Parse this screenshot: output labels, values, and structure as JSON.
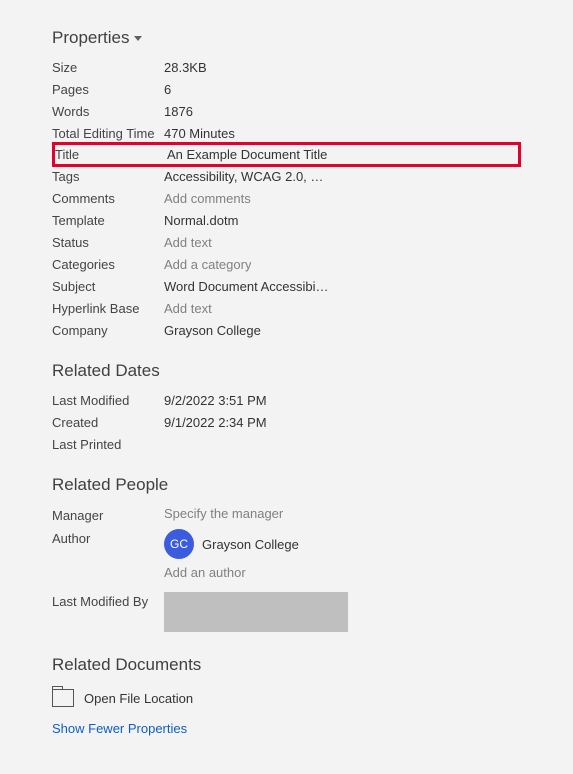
{
  "properties_header": "Properties",
  "properties": [
    {
      "label": "Size",
      "value": "28.3KB",
      "interactable": false
    },
    {
      "label": "Pages",
      "value": "6",
      "interactable": false
    },
    {
      "label": "Words",
      "value": "1876",
      "interactable": false
    },
    {
      "label": "Total Editing Time",
      "value": "470 Minutes",
      "interactable": false
    },
    {
      "label": "Title",
      "value": "An Example Document Title",
      "interactable": true,
      "highlight": true
    },
    {
      "label": "Tags",
      "value": "Accessibility, WCAG 2.0, …",
      "interactable": true
    },
    {
      "label": "Comments",
      "value": "Add comments",
      "placeholder": true,
      "interactable": true
    },
    {
      "label": "Template",
      "value": "Normal.dotm",
      "interactable": false
    },
    {
      "label": "Status",
      "value": "Add text",
      "placeholder": true,
      "interactable": true
    },
    {
      "label": "Categories",
      "value": "Add a category",
      "placeholder": true,
      "interactable": true
    },
    {
      "label": "Subject",
      "value": "Word Document Accessibi…",
      "interactable": true
    },
    {
      "label": "Hyperlink Base",
      "value": "Add text",
      "placeholder": true,
      "interactable": true
    },
    {
      "label": "Company",
      "value": "Grayson College",
      "interactable": true
    }
  ],
  "related_dates_header": "Related Dates",
  "related_dates": [
    {
      "label": "Last Modified",
      "value": "9/2/2022 3:51 PM"
    },
    {
      "label": "Created",
      "value": "9/1/2022 2:34 PM"
    },
    {
      "label": "Last Printed",
      "value": ""
    }
  ],
  "related_people_header": "Related People",
  "manager_label": "Manager",
  "manager_placeholder": "Specify the manager",
  "author_label": "Author",
  "author_initials": "GC",
  "author_name": "Grayson College",
  "add_author_placeholder": "Add an author",
  "last_modified_by_label": "Last Modified By",
  "related_documents_header": "Related Documents",
  "open_file_location_label": "Open File Location",
  "show_fewer_label": "Show Fewer Properties"
}
